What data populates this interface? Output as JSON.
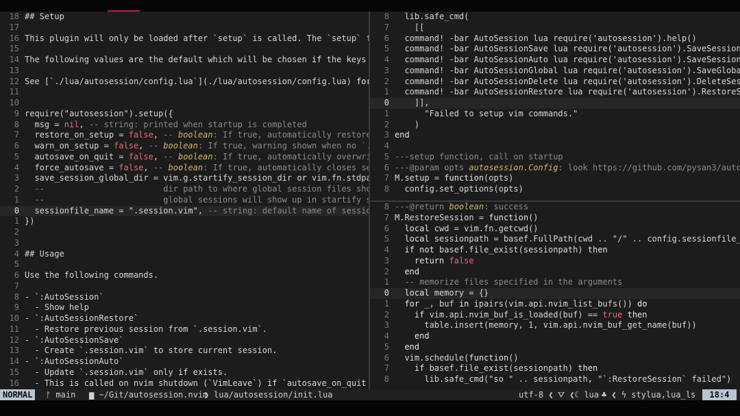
{
  "colors": {
    "mode_bg": "#b8c4d2",
    "bool": "#e06c75",
    "comment": "#8a8a8a",
    "type": "#d0b36a",
    "link": "#8ab4e8"
  },
  "left_pane": {
    "lines": [
      {
        "n": "18",
        "t": "## Setup"
      },
      {
        "n": "17",
        "t": ""
      },
      {
        "n": "16",
        "t": "This plugin will only be loaded after `setup` is called. The `setup` funct"
      },
      {
        "n": "15",
        "t": ""
      },
      {
        "n": "14",
        "t": "The following values are the default which will be chosen if the keys do n"
      },
      {
        "n": "13",
        "t": ""
      },
      {
        "n": "12",
        "t": "See [`./lua/autosession/config.lua`](./lua/autosession/config.lua) for mor"
      },
      {
        "n": "11",
        "t": ""
      },
      {
        "n": "10",
        "t": ""
      },
      {
        "n": "9",
        "t": "require(\"autosession\").setup({"
      },
      {
        "n": "8",
        "t": "  msg = nil, -- string: printed when startup is completed"
      },
      {
        "n": "7",
        "t": "  restore_on_setup = false, -- boolean: If true, automatically restore ses"
      },
      {
        "n": "6",
        "t": "  warn_on_setup = false, -- boolean: If true, warning shown when no `.sess"
      },
      {
        "n": "5",
        "t": "  autosave_on_quit = false, -- boolean: If true, automatically overwrites"
      },
      {
        "n": "4",
        "t": "  force_autosave = false, -- boolean: If true, automatically closes sessio"
      },
      {
        "n": "3",
        "t": "  save_session_global_dir = vim.g.startify_session_dir or vim.fn.stdpath(\""
      },
      {
        "n": "2",
        "t": "  --                        dir path to where global session files should"
      },
      {
        "n": "1",
        "t": "  --                        global sessions will show up in startify scree"
      },
      {
        "n": "0",
        "t": "  sessionfile_name = \".session.vim\", -- string: default name of sessionfil"
      },
      {
        "n": "1",
        "t": "})"
      },
      {
        "n": "2",
        "t": ""
      },
      {
        "n": "3",
        "t": ""
      },
      {
        "n": "4",
        "t": "## Usage"
      },
      {
        "n": "5",
        "t": ""
      },
      {
        "n": "6",
        "t": "Use the following commands."
      },
      {
        "n": "7",
        "t": ""
      },
      {
        "n": "8",
        "t": "- `:AutoSession`"
      },
      {
        "n": "9",
        "t": "  - Show help"
      },
      {
        "n": "10",
        "t": "- `:AutoSessionRestore`"
      },
      {
        "n": "11",
        "t": "  - Restore previous session from `.session.vim`."
      },
      {
        "n": "12",
        "t": "- `:AutoSessionSave`"
      },
      {
        "n": "13",
        "t": "  - Create `.session.vim` to store current session."
      },
      {
        "n": "14",
        "t": "- `:AutoSessionAuto`"
      },
      {
        "n": "15",
        "t": "  - Update `.session.vim` only if exists."
      },
      {
        "n": "16",
        "t": "  - This is called on nvim shutdown (`VimLeave`) if `autosave_on_quit == t"
      }
    ]
  },
  "right_top_pane": {
    "lines": [
      {
        "n": "8",
        "t": "  lib.safe_cmd("
      },
      {
        "n": "7",
        "t": "    [["
      },
      {
        "n": "6",
        "t": "  command! -bar AutoSession lua require('autosession').help()"
      },
      {
        "n": "5",
        "t": "  command! -bar AutoSessionSave lua require('autosession').SaveSession(tru"
      },
      {
        "n": "4",
        "t": "  command! -bar AutoSessionAuto lua require('autosession').SaveSession(fal"
      },
      {
        "n": "3",
        "t": "  command! -bar AutoSessionGlobal lua require('autosession').SaveGlobalSes"
      },
      {
        "n": "2",
        "t": "  command! -bar AutoSessionDelete lua require('autosession').DeleteSession"
      },
      {
        "n": "1",
        "t": "  command! -bar AutoSessionRestore lua require('autosession').RestoreSessi"
      },
      {
        "n": "0",
        "t": "    ]],"
      },
      {
        "n": "1",
        "t": "      \"Failed to setup vim commands.\""
      },
      {
        "n": "2",
        "t": "    )"
      },
      {
        "n": "3",
        "t": "end"
      },
      {
        "n": "4",
        "t": ""
      },
      {
        "n": "5",
        "t": "---setup function, call on startup"
      },
      {
        "n": "6",
        "t": "---@param opts autosession.Config: look https://github.com/pysan3/autoses"
      },
      {
        "n": "7",
        "t": "M.setup = function(opts)"
      },
      {
        "n": "8",
        "t": "  config.set_options(opts)"
      }
    ]
  },
  "right_bottom_pane": {
    "lines": [
      {
        "n": "8",
        "t": "---@return boolean: success"
      },
      {
        "n": "7",
        "t": "M.RestoreSession = function()"
      },
      {
        "n": "6",
        "t": "  local cwd = vim.fn.getcwd()"
      },
      {
        "n": "5",
        "t": "  local sessionpath = basef.FullPath(cwd .. \"/\" .. config.sessionfile_name"
      },
      {
        "n": "4",
        "t": "  if not basef.file_exist(sessionpath) then"
      },
      {
        "n": "3",
        "t": "    return false"
      },
      {
        "n": "2",
        "t": "  end"
      },
      {
        "n": "1",
        "t": "  -- memorize files specified in the arguments"
      },
      {
        "n": "0",
        "t": "  local memory = {}"
      },
      {
        "n": "1",
        "t": "  for _, buf in ipairs(vim.api.nvim_list_bufs()) do"
      },
      {
        "n": "2",
        "t": "    if vim.api.nvim_buf_is_loaded(buf) == true then"
      },
      {
        "n": "3",
        "t": "      table.insert(memory, 1, vim.api.nvim_buf_get_name(buf))"
      },
      {
        "n": "4",
        "t": "    end"
      },
      {
        "n": "5",
        "t": "  end"
      },
      {
        "n": "6",
        "t": "  vim.schedule(function()"
      },
      {
        "n": "7",
        "t": "    if basef.file_exist(sessionpath) then"
      },
      {
        "n": "8",
        "t": "      lib.safe_cmd(\"so \" .. sessionpath, \"`:RestoreSession` failed\")"
      }
    ]
  },
  "statusline": {
    "mode": "NORMAL",
    "branch_icon": "git-branch-icon",
    "branch": "ᚠ main",
    "folder_icon": "folder-icon",
    "cwd": "▆ ~/Git/autosession.nvim",
    "sep": "❯",
    "file": "lua/autosession/init.lua",
    "encoding": "utf-8 ❮",
    "os_icon": "linux-icon",
    "os": "⛛ ❮",
    "filetype": "☾ lua",
    "lsp_icon": "tree-icon",
    "lsp": "♣ ❮ ϟ stylua,lua_ls",
    "position": "18:4"
  }
}
